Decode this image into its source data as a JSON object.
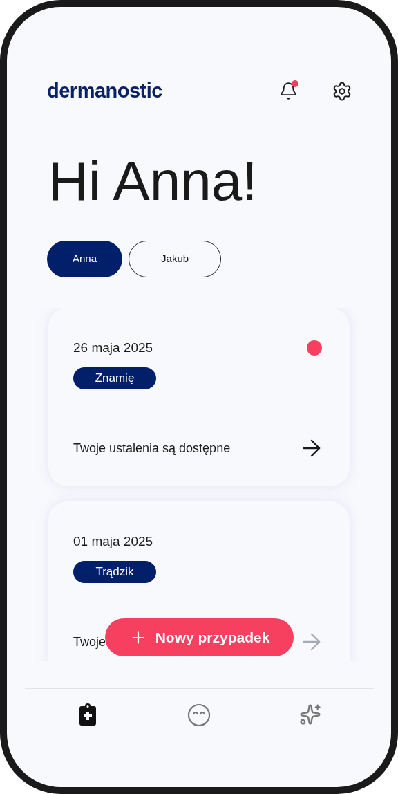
{
  "app": {
    "logo": "dermanostic",
    "notifications_unread": true
  },
  "greeting": "Hi Anna!",
  "profiles": [
    {
      "label": "Anna",
      "selected": true
    },
    {
      "label": "Jakub",
      "selected": false
    }
  ],
  "cases": [
    {
      "date": "26 maja 2025",
      "tag": "Znamię",
      "unread": true,
      "message": "Twoje ustalenia są dostępne",
      "faded": false
    },
    {
      "date": "01 maja 2025",
      "tag": "Trądzik",
      "unread": false,
      "message": "Twoje",
      "faded": true
    }
  ],
  "new_case_button": {
    "label": "Nowy przypadek"
  },
  "nav": [
    {
      "kind": "cases",
      "selected": true
    },
    {
      "kind": "skin",
      "selected": false
    },
    {
      "kind": "ai",
      "selected": false
    }
  ]
}
